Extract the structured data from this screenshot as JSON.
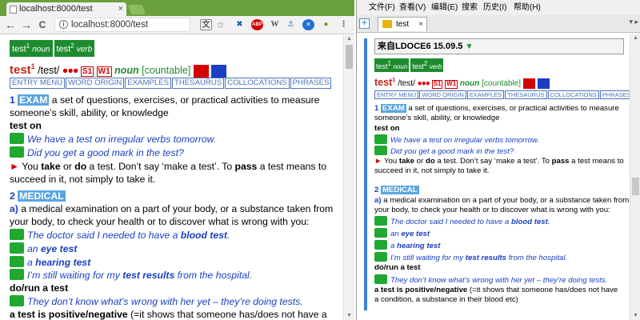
{
  "chrome": {
    "tab_title": "localhost:8000/test",
    "tab_close": "×",
    "back": "←",
    "forward": "→",
    "reload": "C",
    "url": "localhost:8000/test",
    "info": "i",
    "ext": [
      "文",
      "☆",
      "✖",
      "ABP",
      "W",
      "⚓",
      "✕",
      "●",
      "⋮"
    ]
  },
  "gd": {
    "menus": [
      "文件(F)",
      "查看(V)",
      "编辑(E)",
      "搜索",
      "历史(I)",
      "帮助(H)"
    ],
    "add_tab": "+",
    "tab_title": "test",
    "tab_close": "×",
    "tools": "▾ ▸",
    "dict_header": "来自LDOCE6 15.09.5",
    "collapse": "▼"
  },
  "entry": {
    "pos_badges": [
      {
        "word": "test",
        "sup": "1",
        "pos": "noun"
      },
      {
        "word": "test",
        "sup": "2",
        "pos": "verb"
      }
    ],
    "headword": "test",
    "headword_sup": "1",
    "pron": "/test/",
    "dots": "●●●",
    "freq1": "S1",
    "freq2": "W1",
    "pos": "noun",
    "gram": "[countable]",
    "menu_tabs": [
      "ENTRY MENU",
      "WORD ORIGIN",
      "EXAMPLES",
      "THESAURUS",
      "COLLOCATIONS",
      "PHRASES"
    ],
    "sense1": {
      "num": "1",
      "tag": "EXAM",
      "def_l1": "a set of questions, exercises, or practical activities to measure",
      "def_l2": "someone’s skill, ability, or knowledge",
      "pattern": "test on",
      "ex1": "We have a test on irregular verbs tomorrow.",
      "ex2": "Did you get a good mark in the test?",
      "note_arrow": "►",
      "note_l1a": "You",
      "note_take": "take",
      "note_or": "or",
      "note_do": "do",
      "note_l1b": "a test. Don’t say ‘make a test’. To",
      "note_pass": "pass",
      "note_l1c": "a test means to",
      "note_l2": "succeed in it, not simply to take it."
    },
    "sense2": {
      "num": "2",
      "tag": "MEDICAL",
      "sub": "a)",
      "def_l1": "a medical examination on a part of your body, or a substance taken from",
      "def_l2": "your body, to check your health or to discover what is wrong with you:",
      "ex1_pre": "The doctor said I needed to have a",
      "ex1_b": "blood test",
      "ex1_post": ".",
      "ex2_pre": "an",
      "ex2_b": "eye test",
      "ex3_pre": "a",
      "ex3_b": "hearing test",
      "ex4_pre": "I’m still waiting for my",
      "ex4_b": "test results",
      "ex4_post": "from the hospital.",
      "pattern": "do/run a test",
      "ex5": "They don’t know what’s wrong with her yet – they’re doing tests.",
      "phrase": "a test is positive/negative",
      "phrase_def_c": "(=it shows that someone has/does not have a",
      "phrase_def_g1": "(=it shows that someone has/does not have",
      "phrase_def_g2": "a condition, a substance in their blood etc)"
    }
  }
}
